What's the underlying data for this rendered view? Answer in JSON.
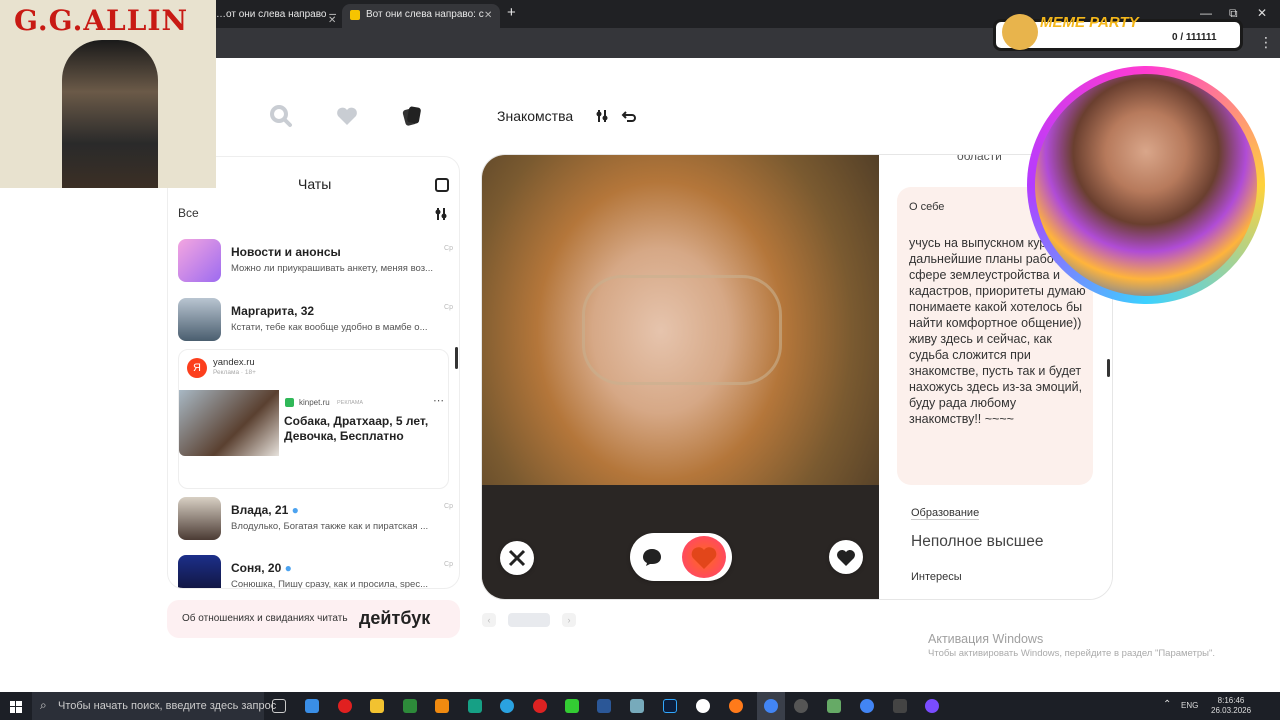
{
  "browser": {
    "tabs": [
      {
        "label": "…от они слева направо — Янд"
      },
      {
        "label": "Вот они слева направо: смотр"
      }
    ],
    "new_tab": "+",
    "min": "—",
    "max": "⧉",
    "close": "✕"
  },
  "nav": {
    "title": "Знакомства"
  },
  "chats": {
    "title": "Чаты",
    "filter": "Все",
    "items": [
      {
        "name": "Новости и анонсы",
        "message": "Можно ли приукрашивать анкету, меняя воз...",
        "time": "Ср"
      },
      {
        "name": "Маргарита, 32",
        "message": "Кстати, тебе как вообще удобно в мамбе о...",
        "time": "Ср"
      },
      {
        "name": "Влада, 21",
        "message": "Влодулько, Богатая также как и пиратская ...",
        "time": "Ср"
      },
      {
        "name": "Соня, 20",
        "message": "Сонюшка, Пишу сразу, как и просила, spec...",
        "time": "Ср"
      }
    ],
    "ad": {
      "source": "yandex.ru",
      "source_sub": "Реклама · 18+",
      "advertiser": "kinpet.ru",
      "ad_tag": "РЕКЛАМА",
      "title": "Собака, Дратхаар, 5 лет, Девочка, Бесплатно",
      "more": "⋯"
    }
  },
  "profile": {
    "region_text": "области",
    "about_label": "О себе",
    "about_text": "учусь на выпускном курсе, дальнейшие планы работать в сфере землеустройства и кадастров, приоритеты думаю понимаете какой хотелось бы найти комфортное общение)) живу здесь и сейчас, как судьба сложится при знакомстве, пусть так и будет нахожусь здесь из-за эмоций, буду рада любому знакомству!! ~~~~",
    "education_label": "Образование",
    "education_value": "Неполное высшее",
    "interests_label": "Интересы"
  },
  "banner": {
    "text": "Об отношениях и свиданиях читать",
    "logo": "дейтбук"
  },
  "windows": {
    "activation_title": "Активация Windows",
    "activation_sub": "Чтобы активировать Windows, перейдите в раздел \"Параметры\"."
  },
  "taskbar": {
    "search": "Чтобы начать поиск, введите здесь запрос",
    "lang": "ENG",
    "time": "8:16:46",
    "date": "26.03.2026"
  },
  "overlays": {
    "gg_title": "G.G.ALLIN",
    "meme_title": "MEME PARTY",
    "meme_count": "0 / 111111"
  }
}
